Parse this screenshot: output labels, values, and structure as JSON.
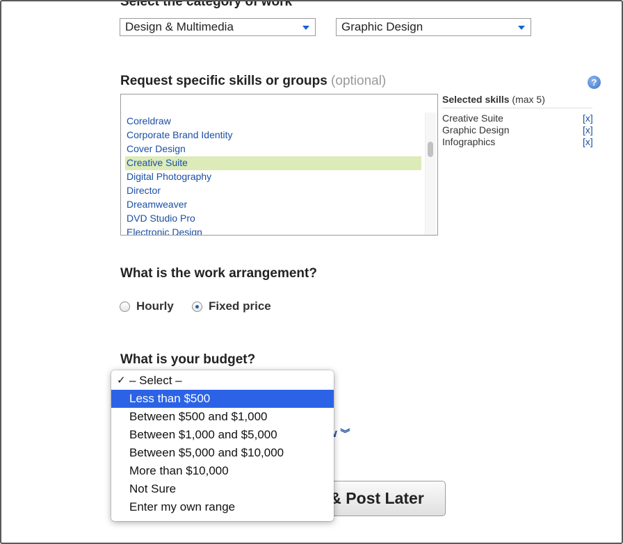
{
  "category": {
    "heading": "Select the category of work",
    "primary_value": "Design & Multimedia",
    "secondary_value": "Graphic Design"
  },
  "skills": {
    "heading": "Request specific skills or groups",
    "optional": "(optional)",
    "search_value": "",
    "list": [
      "Coreldraw",
      "Corporate Brand Identity",
      "Cover Design",
      "Creative Suite",
      "Digital Photography",
      "Director",
      "Dreamweaver",
      "DVD Studio Pro",
      "Electronic Design"
    ],
    "highlighted": "Creative Suite",
    "selected_title": "Selected skills",
    "selected_max": "(max 5)",
    "selected": [
      {
        "name": "Creative Suite",
        "remove": "[x]"
      },
      {
        "name": "Graphic Design",
        "remove": "[x]"
      },
      {
        "name": "Infographics",
        "remove": "[x]"
      }
    ],
    "help_icon": "question-icon"
  },
  "arrangement": {
    "heading": "What is the work arrangement?",
    "options": [
      "Hourly",
      "Fixed price"
    ],
    "selected": "Fixed price"
  },
  "budget": {
    "heading": "What is your budget?",
    "menu": {
      "check_mark": "✓",
      "options": [
        "– Select –",
        "Less than $500",
        "Between $500 and $1,000",
        "Between $1,000 and $5,000",
        "Between $5,000 and $10,000",
        "More than $10,000",
        "Not Sure",
        "Enter my own range"
      ],
      "checked": "– Select –",
      "highlighted": "Less than $500"
    }
  },
  "partial_link_fragment": "ew",
  "actions": {
    "save_later": "Save & Post Later"
  },
  "colors": {
    "link": "#1a4fa3",
    "highlight_skill": "#dcebb8",
    "menu_highlight": "#2c63e6"
  }
}
